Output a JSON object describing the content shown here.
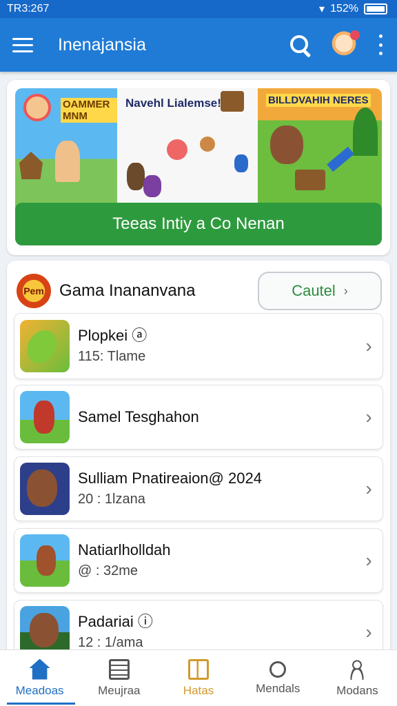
{
  "status": {
    "time": "TR3:267",
    "battery": "152%"
  },
  "appbar": {
    "title": "Inenajansia"
  },
  "banner": {
    "panel1_text": "OAMMER MNM",
    "panel2_text": "Navehl Lialemse!",
    "panel3_text": "BILLDVAHIH NERES",
    "button_label": "Teeas Intiy a Co Nenan"
  },
  "list": {
    "logo_text": "Pem",
    "title": "Gama Inananvana",
    "action_label": "Cautel",
    "items": [
      {
        "title": "Plopkei ⓐ",
        "subtitle": "115: Tlame"
      },
      {
        "title": "Samel Tesghahon",
        "subtitle": ""
      },
      {
        "title": "Sulliam Pnatireaion@ 2024",
        "subtitle": "20 : 1lzana"
      },
      {
        "title": "Natiarlholldah",
        "subtitle": "@ : 32me"
      },
      {
        "title": "Padariai ⓘ",
        "subtitle": "12 : 1/ama"
      }
    ]
  },
  "nav": [
    {
      "label": "Meadoas",
      "icon": "home-icon"
    },
    {
      "label": "Meujraa",
      "icon": "news-icon"
    },
    {
      "label": "Hatas",
      "icon": "box-icon"
    },
    {
      "label": "Mendals",
      "icon": "search-icon"
    },
    {
      "label": "Modans",
      "icon": "user-icon"
    }
  ],
  "colors": {
    "primary": "#1f7bd6",
    "accent_green": "#2e9a3e",
    "gold": "#d29a2a"
  }
}
